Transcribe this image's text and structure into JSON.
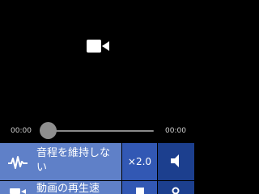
{
  "player": {
    "video_icon": "video-camera-icon",
    "current_time": "00:00",
    "duration": "00:00",
    "progress": 0
  },
  "controls": {
    "pitch_button": {
      "icon": "waveform-icon",
      "label": "音程を維持しない"
    },
    "speed_button": {
      "label": "×2.0"
    },
    "volume_button": {
      "icon": "speaker-icon"
    },
    "second_row": {
      "label": "動画の再生速"
    }
  },
  "colors": {
    "background": "#000000",
    "pitch_button": "#5f80c8",
    "speed_button": "#3258b4",
    "volume_button": "#1c3f8e",
    "slider_thumb": "#8e8e8e"
  }
}
